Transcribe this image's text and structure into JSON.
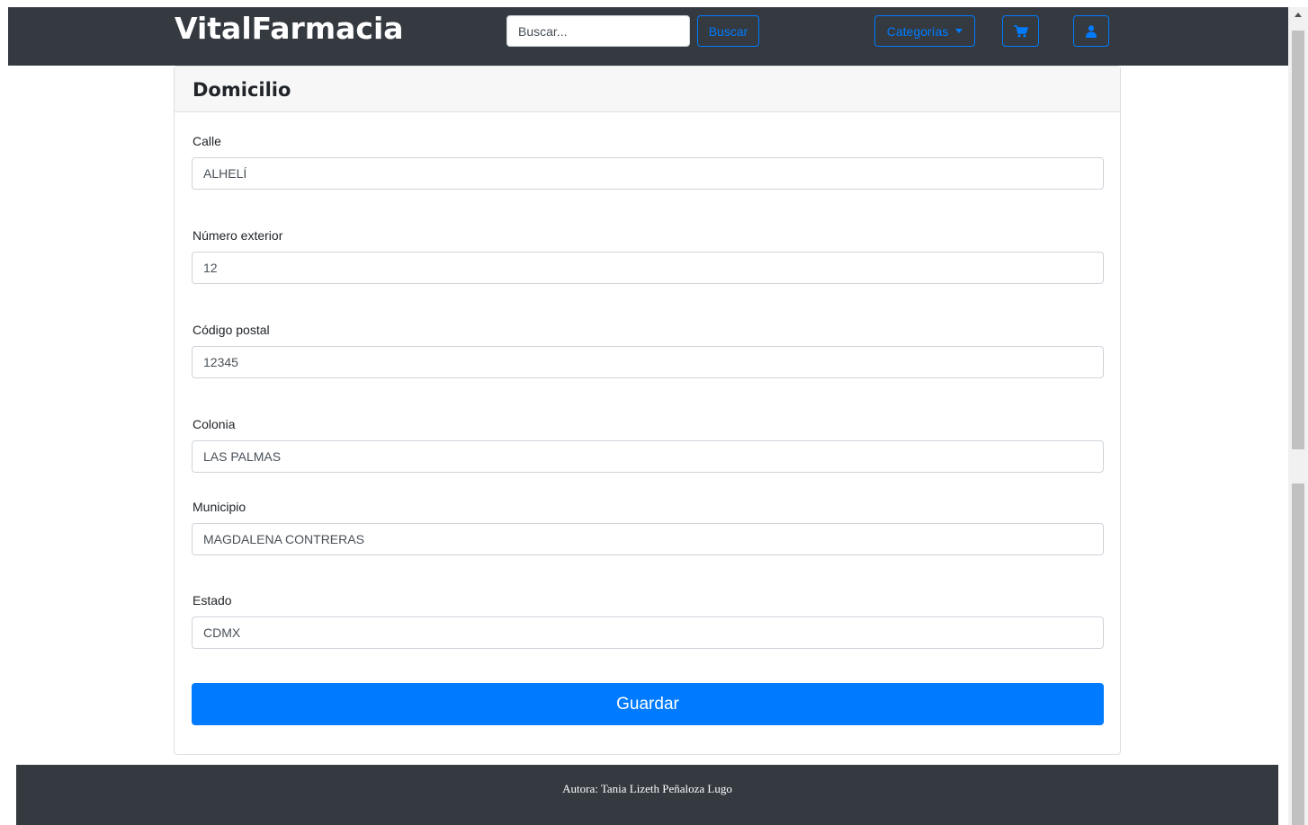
{
  "navbar": {
    "brand": "VitalFarmacia",
    "search_placeholder": "Buscar...",
    "search_button": "Buscar",
    "categories_button": "Categorías",
    "cart_icon": "cart-icon",
    "user_icon": "user-icon"
  },
  "form": {
    "title": "Domicilio",
    "fields": [
      {
        "label": "Calle",
        "value": "ALHELÍ"
      },
      {
        "label": "Número exterior",
        "value": "12"
      },
      {
        "label": "Código postal",
        "value": "12345"
      },
      {
        "label": "Colonia",
        "value": "LAS PALMAS"
      },
      {
        "label": "Municipio",
        "value": "MAGDALENA CONTRERAS"
      },
      {
        "label": "Estado",
        "value": "CDMX"
      }
    ],
    "submit": "Guardar"
  },
  "footer": {
    "text": "Autora: Tania Lizeth Peñaloza Lugo"
  },
  "colors": {
    "navbar_bg": "#343a40",
    "primary": "#007bff"
  }
}
